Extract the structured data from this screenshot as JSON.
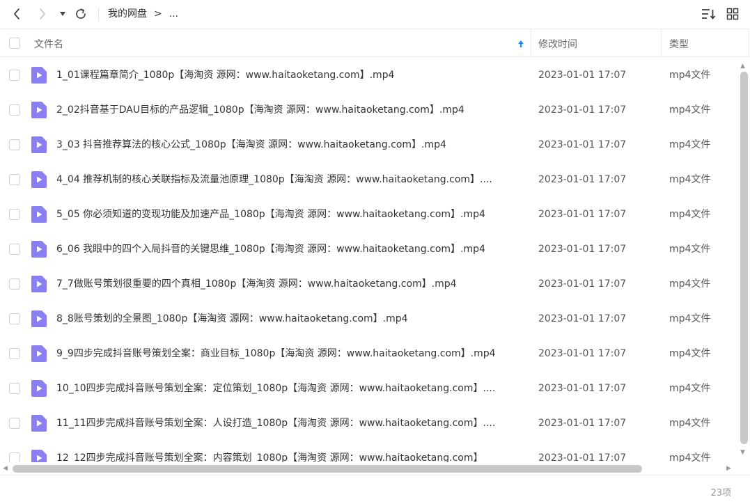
{
  "breadcrumb": {
    "root": "我的网盘",
    "separator": ">",
    "more": "..."
  },
  "columns": {
    "name": "文件名",
    "modified": "修改时间",
    "type": "类型"
  },
  "colors": {
    "accent": "#1a90ff",
    "file_icon": "#8a7ff0",
    "scrollbar": "#c8c8c8"
  },
  "icons": {
    "back": "chevron-left-icon",
    "forward": "chevron-right-icon",
    "history": "caret-down-icon",
    "refresh": "refresh-icon",
    "sort": "sort-icon",
    "view": "grid-view-icon",
    "sort_indicator": "arrow-up-icon",
    "file": "video-file-icon"
  },
  "files": [
    {
      "name": "1_01课程篇章简介_1080p【海淘资 源网：www.haitaoketang.com】.mp4",
      "modified": "2023-01-01 17:07",
      "type": "mp4文件"
    },
    {
      "name": "2_02抖音基于DAU目标的产品逻辑_1080p【海淘资 源网：www.haitaoketang.com】.mp4",
      "modified": "2023-01-01 17:07",
      "type": "mp4文件"
    },
    {
      "name": "3_03 抖音推荐算法的核心公式_1080p【海淘资 源网：www.haitaoketang.com】.mp4",
      "modified": "2023-01-01 17:07",
      "type": "mp4文件"
    },
    {
      "name": "4_04 推荐机制的核心关联指标及流量池原理_1080p【海淘资 源网：www.haitaoketang.com】....",
      "modified": "2023-01-01 17:07",
      "type": "mp4文件"
    },
    {
      "name": "5_05 你必须知道的变现功能及加速产品_1080p【海淘资 源网：www.haitaoketang.com】.mp4",
      "modified": "2023-01-01 17:07",
      "type": "mp4文件"
    },
    {
      "name": "6_06 我眼中的四个入局抖音的关键思维_1080p【海淘资 源网：www.haitaoketang.com】.mp4",
      "modified": "2023-01-01 17:07",
      "type": "mp4文件"
    },
    {
      "name": "7_7做账号策划很重要的四个真相_1080p【海淘资 源网：www.haitaoketang.com】.mp4",
      "modified": "2023-01-01 17:07",
      "type": "mp4文件"
    },
    {
      "name": "8_8账号策划的全景图_1080p【海淘资 源网：www.haitaoketang.com】.mp4",
      "modified": "2023-01-01 17:07",
      "type": "mp4文件"
    },
    {
      "name": "9_9四步完成抖音账号策划全案：商业目标_1080p【海淘资 源网：www.haitaoketang.com】.mp4",
      "modified": "2023-01-01 17:07",
      "type": "mp4文件"
    },
    {
      "name": "10_10四步完成抖音账号策划全案：定位策划_1080p【海淘资 源网：www.haitaoketang.com】....",
      "modified": "2023-01-01 17:07",
      "type": "mp4文件"
    },
    {
      "name": "11_11四步完成抖音账号策划全案：人设打造_1080p【海淘资 源网：www.haitaoketang.com】....",
      "modified": "2023-01-01 17:07",
      "type": "mp4文件"
    },
    {
      "name": "12_12四步完成抖音账号策划全案：内容策划_1080p【海淘资 源网：www.haitaoketang.com】",
      "modified": "2023-01-01 17:07",
      "type": "mp4文件"
    }
  ],
  "footer": {
    "item_count": "23项"
  }
}
